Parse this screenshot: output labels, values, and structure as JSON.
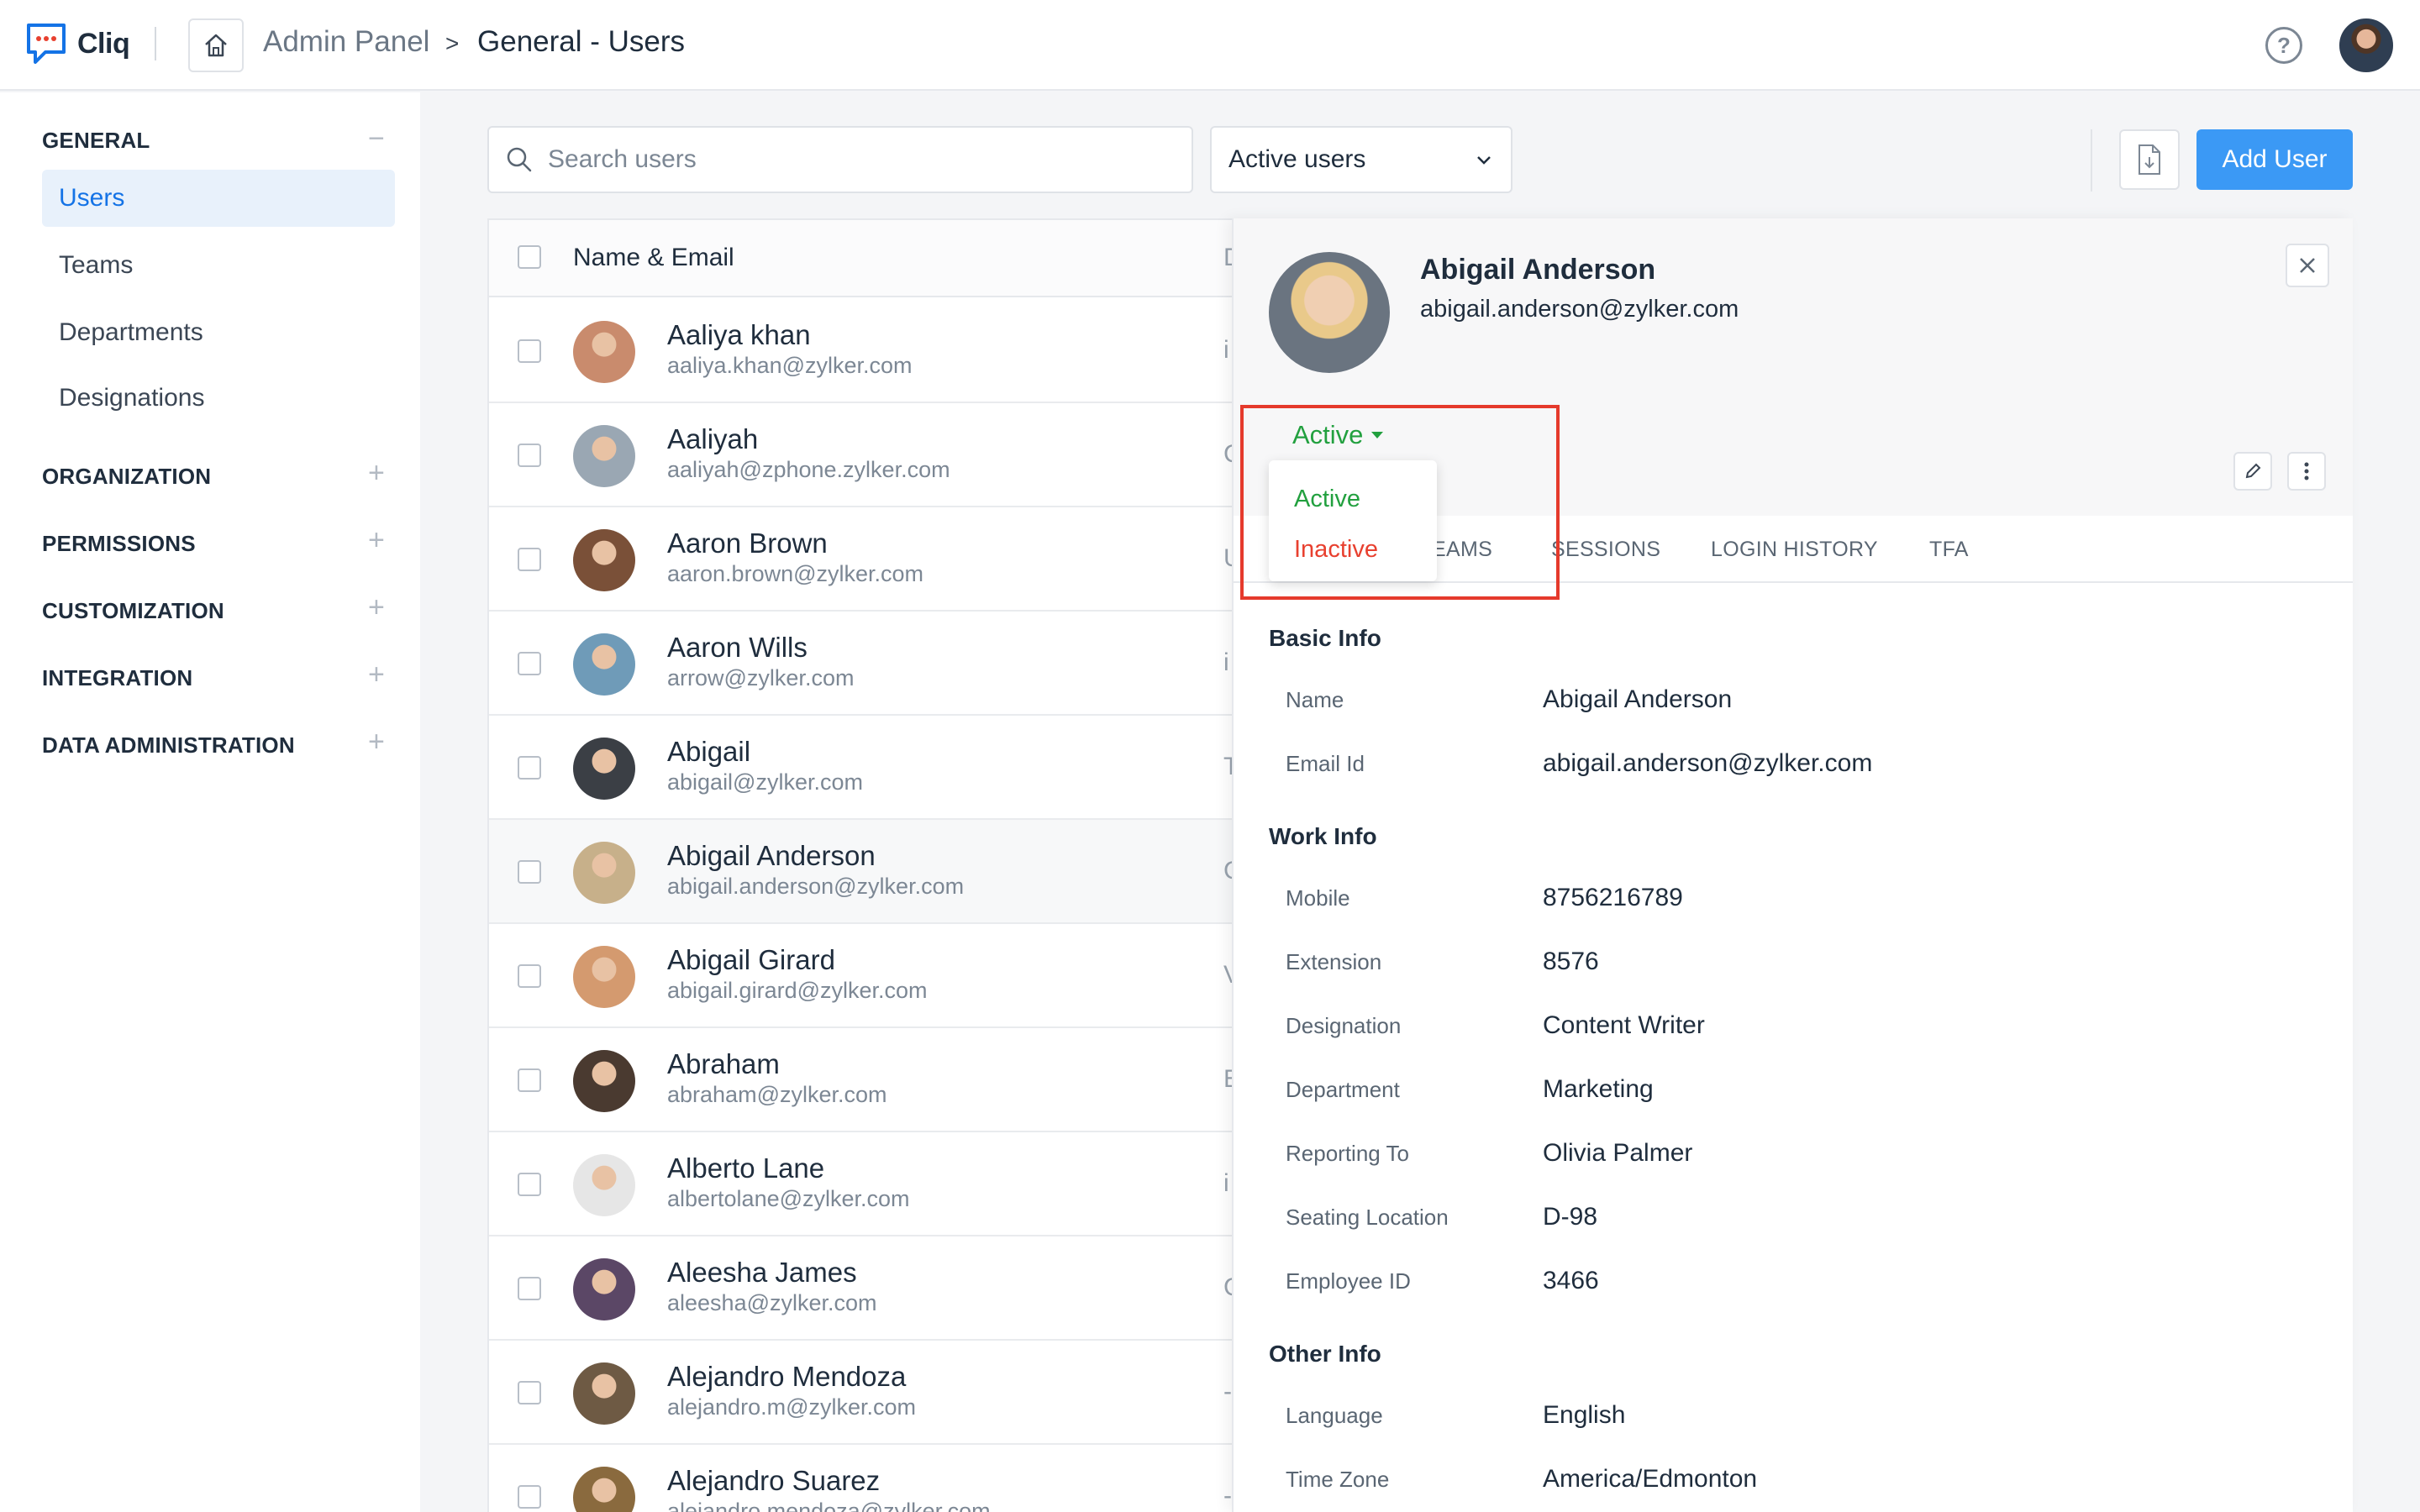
{
  "app": {
    "name": "Cliq"
  },
  "breadcrumb": {
    "root": "Admin Panel",
    "separator": ">",
    "current": "General - Users"
  },
  "sidebar": {
    "sections": [
      {
        "label": "GENERAL",
        "toggle": "−",
        "items": [
          "Users",
          "Teams",
          "Departments",
          "Designations"
        ]
      },
      {
        "label": "ORGANIZATION",
        "toggle": "+"
      },
      {
        "label": "PERMISSIONS",
        "toggle": "+"
      },
      {
        "label": "CUSTOMIZATION",
        "toggle": "+"
      },
      {
        "label": "INTEGRATION",
        "toggle": "+"
      },
      {
        "label": "DATA ADMINISTRATION",
        "toggle": "+"
      }
    ],
    "active_item": "Users"
  },
  "toolbar": {
    "search_placeholder": "Search users",
    "filter_value": "Active users",
    "add_label": "Add User"
  },
  "list": {
    "header": {
      "name_email": "Name & Email",
      "col2_partial": "D"
    },
    "rows": [
      {
        "name": "Aaliya khan",
        "email": "aaliya.khan@zylker.com",
        "col2": "i"
      },
      {
        "name": "Aaliyah",
        "email": "aaliyah@zphone.zylker.com",
        "col2": "C"
      },
      {
        "name": "Aaron Brown",
        "email": "aaron.brown@zylker.com",
        "col2": "U"
      },
      {
        "name": "Aaron Wills",
        "email": "arrow@zylker.com",
        "col2": "i"
      },
      {
        "name": "Abigail",
        "email": "abigail@zylker.com",
        "col2": "T"
      },
      {
        "name": "Abigail Anderson",
        "email": "abigail.anderson@zylker.com",
        "col2": "C"
      },
      {
        "name": "Abigail Girard",
        "email": "abigail.girard@zylker.com",
        "col2": "V"
      },
      {
        "name": "Abraham",
        "email": "abraham@zylker.com",
        "col2": "E"
      },
      {
        "name": "Alberto Lane",
        "email": "albertolane@zylker.com",
        "col2": "i"
      },
      {
        "name": "Aleesha James",
        "email": "aleesha@zylker.com",
        "col2": "C"
      },
      {
        "name": "Alejandro Mendoza",
        "email": "alejandro.m@zylker.com",
        "col2": "-"
      },
      {
        "name": "Alejandro Suarez",
        "email": "alejandro.mendoza@zylker.com",
        "col2": "-"
      }
    ],
    "avatar_colors": [
      "#c98b6d",
      "#9aa7b3",
      "#7a5038",
      "#6f9bb8",
      "#3b3f45",
      "#c7b08a",
      "#d49a6f",
      "#4a3a30",
      "#e6e6e6",
      "#5b4766",
      "#6e5a44",
      "#8a6a3e"
    ]
  },
  "detail": {
    "name": "Abigail Anderson",
    "email": "abigail.anderson@zylker.com",
    "status": "Active",
    "status_options": [
      {
        "label": "Active",
        "color": "#22a03f"
      },
      {
        "label": "Inactive",
        "color": "#e8402f"
      }
    ],
    "tabs": [
      "EAMS",
      "SESSIONS",
      "LOGIN HISTORY",
      "TFA"
    ],
    "sections": {
      "basic": {
        "title": "Basic Info",
        "fields": [
          {
            "label": "Name",
            "value": "Abigail Anderson"
          },
          {
            "label": "Email Id",
            "value": "abigail.anderson@zylker.com"
          }
        ]
      },
      "work": {
        "title": "Work Info",
        "fields": [
          {
            "label": "Mobile",
            "value": "8756216789"
          },
          {
            "label": "Extension",
            "value": "8576"
          },
          {
            "label": "Designation",
            "value": "Content Writer"
          },
          {
            "label": "Department",
            "value": "Marketing"
          },
          {
            "label": "Reporting To",
            "value": "Olivia Palmer"
          },
          {
            "label": "Seating Location",
            "value": "D-98"
          },
          {
            "label": "Employee ID",
            "value": "3466"
          }
        ]
      },
      "other": {
        "title": "Other Info",
        "fields": [
          {
            "label": "Language",
            "value": "English"
          },
          {
            "label": "Time Zone",
            "value": "America/Edmonton"
          }
        ]
      }
    }
  },
  "colors": {
    "accent": "#3b99f5",
    "active_nav": "#1473e6",
    "status_active": "#22a03f",
    "status_inactive": "#e8402f",
    "highlight_box": "#e53a2c"
  }
}
